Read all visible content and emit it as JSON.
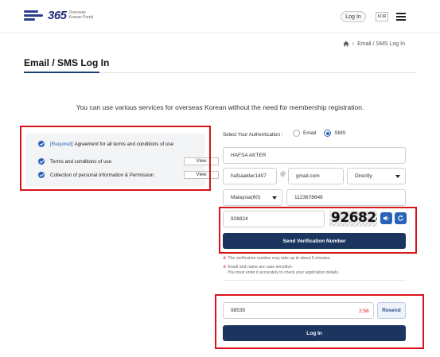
{
  "header": {
    "logo_number": "365",
    "logo_subtitle_line1": "Overseas",
    "logo_subtitle_line2": "Korean Portal",
    "login_button": "Log In",
    "language_button": "KOR"
  },
  "breadcrumb": {
    "path": "Email / SMS Log In"
  },
  "page_title": "Email / SMS Log In",
  "intro_text": "You can use various services for overseas Korean without the need for membership registration.",
  "terms": {
    "all_required_tag": "[Required]",
    "all_label": "Agreement for all terms and conditions of use",
    "item1_label": "Terms and conditions of use",
    "item2_label": "Collection of personal Information & Permission",
    "view_label": "View"
  },
  "auth": {
    "label": "Select Your Authentication :",
    "option_email": "Email",
    "option_sms": "SMS",
    "selected": "SMS"
  },
  "form": {
    "name_value": "HAFSA AKTER",
    "email_local_value": "hafsaakter1407",
    "at_symbol": "@",
    "email_domain_value": "gmail.com",
    "email_domain_select": "Directly",
    "country_select": "Malaysia(60)",
    "phone_value": "1123678648",
    "captcha_input_value": "926824",
    "captcha_image_text": "926824",
    "send_button": "Send Verification Number",
    "verification_input_value": "98535",
    "timer_text": "2:58",
    "resend_button": "Resend",
    "login_button": "Log In"
  },
  "notes": {
    "note1": "The verification number may take up to about 5 minutes.",
    "note2_line1": "Email and name are case sensitive.",
    "note2_line2": "You must enter it accurately to check your application details."
  },
  "colors": {
    "primary_navy": "#1c355f",
    "accent_blue": "#2a62b8",
    "highlight_red": "#d9141c"
  }
}
